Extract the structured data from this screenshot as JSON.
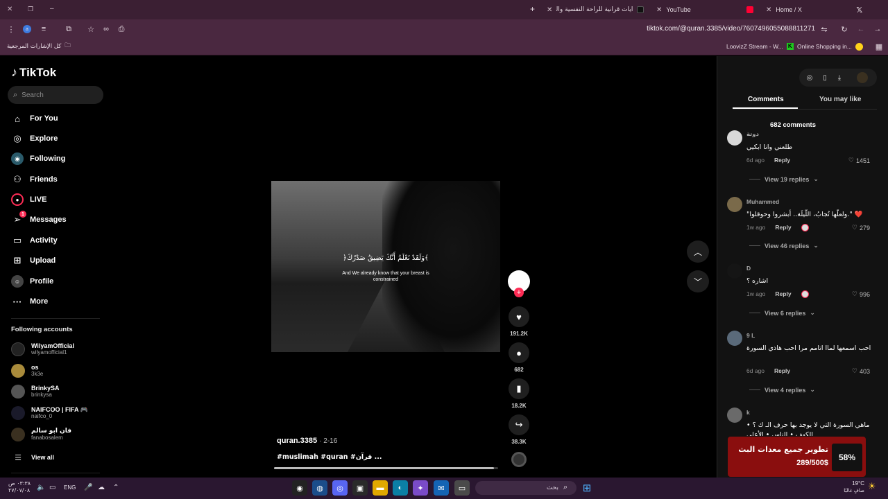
{
  "browser": {
    "tabs": [
      {
        "label": "آيات قرآنية للراحة النفسية والتيس",
        "active": true
      },
      {
        "label": "YouTube"
      },
      {
        "label": "Home / X"
      }
    ],
    "url": "tiktok.com/@quran.3385/video/7607496055088811271",
    "bookmarks_all": "كل الإشارات المرجعية",
    "bookmark1": "LoovizZ Stream - W...",
    "bookmark2": "Online Shopping in..."
  },
  "sidebar": {
    "logo": "TikTok",
    "search_placeholder": "Search",
    "nav": [
      {
        "label": "For You",
        "icon": "home-icon"
      },
      {
        "label": "Explore",
        "icon": "compass-icon"
      },
      {
        "label": "Following",
        "icon": "following-icon"
      },
      {
        "label": "Friends",
        "icon": "friends-icon"
      },
      {
        "label": "LIVE",
        "icon": "live-icon"
      },
      {
        "label": "Messages",
        "icon": "messages-icon",
        "badge": "1"
      },
      {
        "label": "Activity",
        "icon": "activity-icon"
      },
      {
        "label": "Upload",
        "icon": "upload-icon"
      },
      {
        "label": "Profile",
        "icon": "profile-icon"
      },
      {
        "label": "More",
        "icon": "more-icon"
      }
    ],
    "following_title": "Following accounts",
    "accounts": [
      {
        "name": "WilyamOfficial",
        "user": "wilyamofficial1"
      },
      {
        "name": "os",
        "user": "3k3e"
      },
      {
        "name": "BrinkySA",
        "user": "brinkysa"
      },
      {
        "name": "NAIFCOO | FIFA 🎮",
        "user": "naifco_0"
      },
      {
        "name": "فان ابو سالم",
        "user": "fanabosalem"
      }
    ],
    "view_all": "View all"
  },
  "video": {
    "caption_ar": "﴿وَلَقَدْ نَعْلَمُ أَنَّكَ يَضِيقُ صَدْرُكَ﴾",
    "caption_en": "And We already know that your breast is constrained",
    "author": "quran.3385",
    "date": "· 2-16",
    "tags": "#muslimah #quran #قرآن ...",
    "progress": 0.98,
    "likes": "191.2K",
    "comments": "682",
    "saves": "18.2K",
    "shares": "38.3K"
  },
  "panel": {
    "tab_comments": "Comments",
    "tab_may_like": "You may like",
    "count": "682 comments",
    "comments": [
      {
        "user": "دوتة",
        "text": "طلعني وانا ابكيي",
        "time": "6d ago",
        "likes": "1451",
        "replies": "View 19 replies"
      },
      {
        "user": "Muhammed",
        "text": "❤️ \".ولعلّها تُجابُ، اللّيلَة.. أبشروا وحوقلوا\"",
        "time": "1w ago",
        "likes": "279",
        "replies": "View 46 replies"
      },
      {
        "user": "D",
        "text": "اشاره ؟",
        "time": "1w ago",
        "likes": "996",
        "replies": "View 6 replies"
      },
      {
        "user": "9 L",
        "text": "احب اسمعها لماا اتامم مرا احب هاذي السورة",
        "time": "6d ago",
        "likes": "403",
        "replies": "View 4 replies"
      },
      {
        "user": "k",
        "text": "ماهي السورة التي لا يوجد بها حرف الـ ك ؟ • الكهف • الناس • الأعلى"
      }
    ],
    "reply_label": "Reply"
  },
  "promo": {
    "title": "تطوير جميع معدات البث",
    "amount": "289/500$",
    "percent": "58%"
  },
  "taskbar": {
    "time": "٠٣:٣٨ ص",
    "date": "٢٧/٠٧/٠٨",
    "lang": "ENG",
    "search": "بحث",
    "weather_temp": "19°C",
    "weather_desc": "صافٍ غالبًا"
  }
}
